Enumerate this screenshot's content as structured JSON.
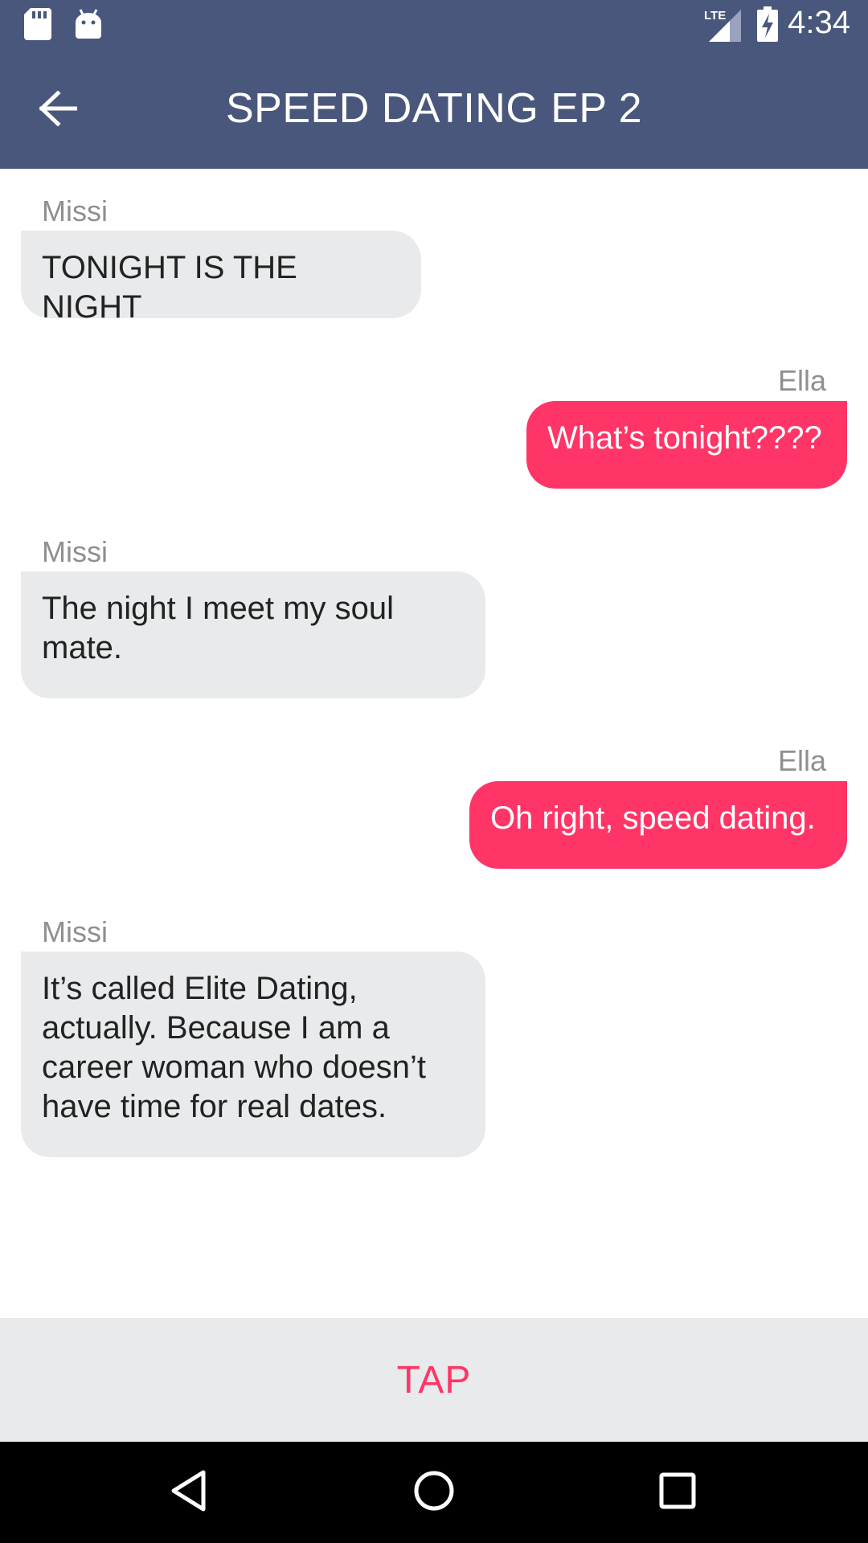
{
  "status_bar": {
    "time": "4:34",
    "network": "LTE",
    "icons": [
      "sd-card-icon",
      "android-icon",
      "lte-signal-icon",
      "battery-charging-icon"
    ]
  },
  "app_bar": {
    "title": "SPEED DATING EP 2",
    "back_icon": "back-arrow-icon"
  },
  "messages": [
    {
      "sender": "Missi",
      "text": "TONIGHT IS THE NIGHT",
      "side": "incoming"
    },
    {
      "sender": "Ella",
      "text": "What’s tonight????",
      "side": "outgoing"
    },
    {
      "sender": "Missi",
      "text": "The night I meet my soul mate.",
      "side": "incoming"
    },
    {
      "sender": "Ella",
      "text": "Oh right, speed dating.",
      "side": "outgoing"
    },
    {
      "sender": "Missi",
      "text": "It’s called Elite Dating, actually. Because I am a career woman who doesn’t have time for real dates.",
      "side": "incoming"
    }
  ],
  "tap_button": {
    "label": "TAP"
  },
  "nav_bar": {
    "icons": [
      "nav-back-icon",
      "nav-home-icon",
      "nav-recents-icon"
    ]
  },
  "colors": {
    "header": "#4a577c",
    "accent": "#ff3567",
    "incoming_bubble": "#e8eaeb",
    "sender_text": "#8f8f8f"
  }
}
